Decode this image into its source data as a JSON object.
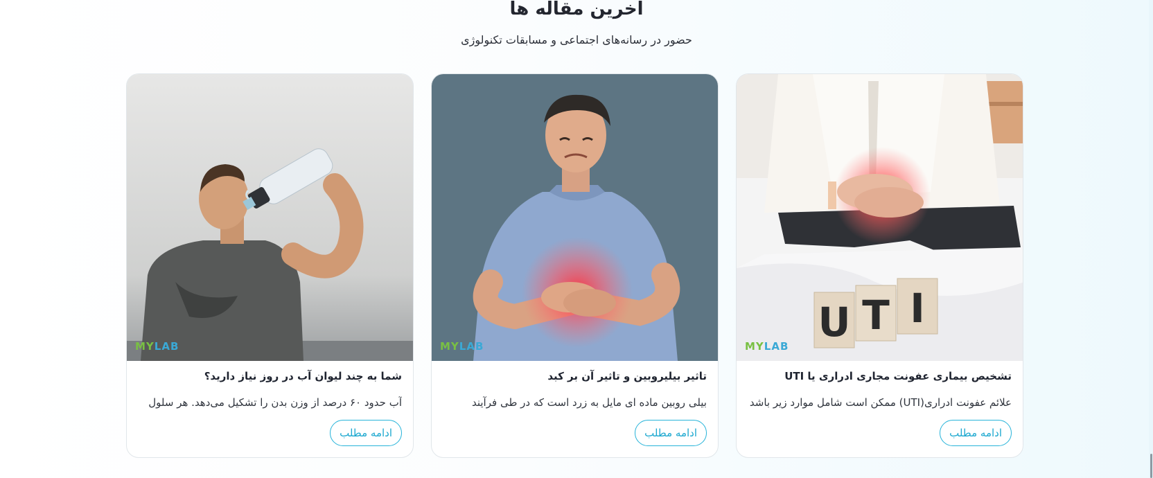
{
  "section": {
    "title": "آخرین مقاله ها",
    "subtitle": "حضور در رسانه‌های اجتماعی و مسابقات تکنولوژی"
  },
  "brand": {
    "watermark_part1": "MY",
    "watermark_part2": "LAB",
    "accent_color": "#26b3d9",
    "watermark_green": "#79c043",
    "watermark_blue": "#3aa9d6"
  },
  "articles": [
    {
      "title": "تشخیص بیماری عفونت مجاری ادراری یا UTI",
      "excerpt": "علائم عفونت ادراری(UTI) ممکن است شامل موارد زیر باشد",
      "button_label": "ادامه مطلب",
      "image_text": [
        "U",
        "T",
        "I"
      ]
    },
    {
      "title": "تاثیر بیلیروبین و تاثیر آن بر کبد",
      "excerpt": "بیلی روبین ماده ای مایل به زرد است که در طی فرآیند",
      "button_label": "ادامه مطلب"
    },
    {
      "title": "شما به چند لیوان آب در روز نیاز دارید؟",
      "excerpt": "آب حدود ۶۰ درصد از وزن بدن را تشکیل می‌دهد. هر سلول",
      "button_label": "ادامه مطلب"
    }
  ]
}
